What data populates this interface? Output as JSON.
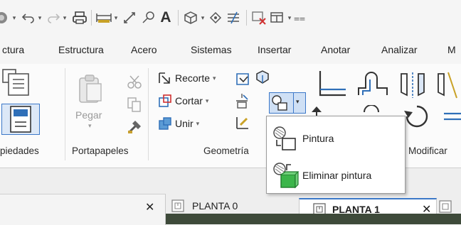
{
  "quick_access": {
    "icons": [
      "app-icon",
      "undo-icon",
      "redo-icon",
      "print-icon",
      "measure-icon",
      "align-icon",
      "tag-icon",
      "text-icon",
      "3d-view-icon",
      "section-icon",
      "thin-lines-icon",
      "close-hidden-icon",
      "switch-windows-icon",
      "customize-icon"
    ],
    "text_icon_glyph": "A"
  },
  "tabs": [
    "ctura",
    "Estructura",
    "Acero",
    "Sistemas",
    "Insertar",
    "Anotar",
    "Analizar",
    "M"
  ],
  "ribbon": {
    "panels": {
      "properties": {
        "label": "piedades"
      },
      "clipboard": {
        "label": "Portapapeles",
        "paste_label": "Pegar"
      },
      "geometry": {
        "label": "Geometría",
        "cope_label": "Recorte",
        "cut_label": "Cortar",
        "join_label": "Unir"
      },
      "modify": {
        "label": "Modificar"
      }
    }
  },
  "paint_menu": {
    "items": [
      {
        "label": "Pintura",
        "icon": "paint-icon"
      },
      {
        "label": "Eliminar pintura",
        "icon": "remove-paint-icon"
      }
    ]
  },
  "views": {
    "close_glyph": "✕",
    "tabs": [
      {
        "label": "PLANTA 0",
        "active": false
      },
      {
        "label": "PLANTA 1",
        "active": true
      }
    ]
  },
  "colors": {
    "accent_blue": "#2f6fb8",
    "active_tab_border": "#3c78c8",
    "green_box": "#3bb54a",
    "canvas": "#3e4a3a"
  }
}
